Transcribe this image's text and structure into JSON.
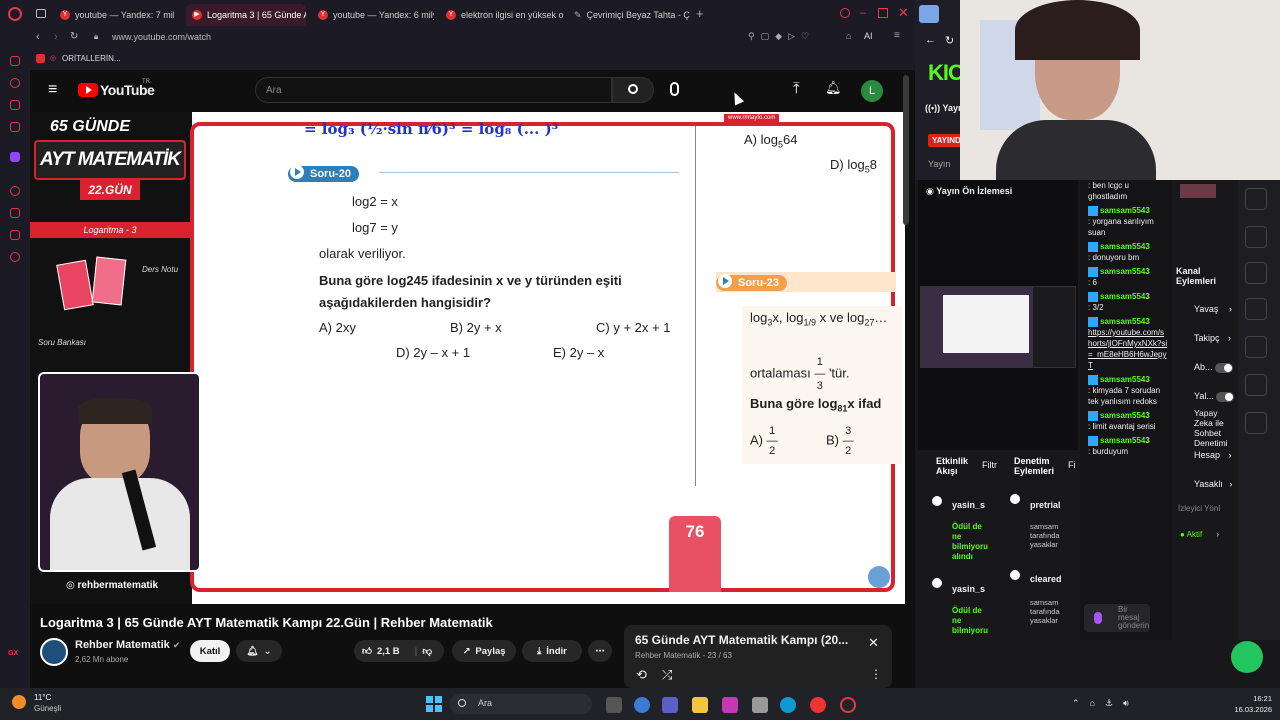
{
  "browser": {
    "tabs": [
      {
        "label": "youtube — Yandex: 7 milyon",
        "active": false
      },
      {
        "label": "Logaritma 3 | 65 Günde A",
        "active": true
      },
      {
        "label": "youtube — Yandex: 6 milyo",
        "active": false
      },
      {
        "label": "elektron ilgisi en yüksek o",
        "active": false
      },
      {
        "label": "Çevrimiçi Beyaz Tahta - Ç",
        "active": false
      }
    ],
    "address": "www.youtube.com/watch",
    "bookmark": "ORİTALLERİN...",
    "ai_label": "AI"
  },
  "youtube": {
    "logo": "YouTube",
    "country": "TR",
    "search_placeholder": "Ara",
    "avatar": "L"
  },
  "video": {
    "promo_title_top": "65 GÜNDE",
    "promo_title_main": "AYT MATEMATİK",
    "promo_day": "22.GÜN",
    "promo_topic": "Logaritma - 3",
    "promo_note": "Ders Notu",
    "promo_bank": "Soru Bankası",
    "instagram": "rehbermatematik",
    "site": "www.rmtayfo.com",
    "page_number": "76",
    "soru20": {
      "head": "Soru-20",
      "line1": "log2 = x",
      "line2": "log7 = y",
      "line3": "olarak veriliyor.",
      "question": "Buna göre log245 ifadesinin x ve y türünden eşiti aşağıdakilerden hangisidir?",
      "opts": [
        "A) 2xy",
        "B) 2y + x",
        "C) y + 2x + 1",
        "D) 2y – x + 1",
        "E) 2y – x"
      ]
    },
    "soru23": {
      "head": "Soru-23",
      "text_a": "log",
      "text_mid": "ortalaması",
      "text_tur": "'tür.",
      "question": "Buna göre log",
      "q_tail": "x ifad",
      "opt_a": "A)",
      "opt_b": "B)"
    },
    "right_top": {
      "a": "A) log",
      "a_base": "5",
      "a_val": "64",
      "d": "D) log",
      "d_base": "5",
      "d_val": "8"
    }
  },
  "below": {
    "title": "Logaritma 3 | 65 Günde AYT Matematik Kampı 22.Gün | Rehber Matematik",
    "channel": "Rehber Matematik",
    "subs": "2,62 Mn abone",
    "join": "Katıl",
    "likes": "2,1 B",
    "share": "Paylaş",
    "download": "İndir"
  },
  "playlist": {
    "title": "65 Günde AYT Matematik Kampı (20...",
    "meta": "Rehber Matematik - 23 / 63"
  },
  "kick": {
    "logo": "KIC",
    "yayin": "Yayın",
    "yayinda": "YAYINDA",
    "onizleme": "Yayın Ön İzlemesi",
    "chat": [
      {
        "user": "",
        "text": ": ben lcgc u ghostladım"
      },
      {
        "user": "samsam5543",
        "text": ": yorgana sarılıyım suan"
      },
      {
        "user": "samsam5543",
        "text": ": donuyoru bm"
      },
      {
        "user": "samsam5543",
        "text": ": 6"
      },
      {
        "user": "samsam5543",
        "text": ": 3/2"
      },
      {
        "user": "samsam5543",
        "text": "https://youtube.com/shorts/jlOFnMyxNXk?si=_mE8eHB6H6wJepyT"
      },
      {
        "user": "samsam5543",
        "text": ": kimyada 7 sorudan tek yanlısım redoks"
      },
      {
        "user": "samsam5543",
        "text": ": limit avantaj serisi"
      },
      {
        "user": "samsam5543",
        "text": ": burduyum"
      }
    ],
    "send_placeholder": "Bir mesaj gönderin",
    "side": {
      "kanal": "Kanal Eylemleri",
      "yavas": "Yavaş",
      "takipci": "Takipç",
      "abone": "Ab...",
      "yal": "Yal...",
      "yapay": "Yapay Zeka ile Sohbet Denetimi",
      "hesap": "Hesap",
      "yasakli": "Yasaklı",
      "izleyici": "İzleyici Yönl",
      "aktif": "Aktif"
    },
    "events": {
      "etkinlik": "Etkinlik Akışı",
      "filtre": "Filtr",
      "denetim": "Denetim Eylemleri",
      "f": "Fi",
      "rows": [
        {
          "name": "yasin_s",
          "desc": "Ödül de ne bilmiyoru alındı"
        },
        {
          "name": "yasin_s",
          "desc": "Ödül de ne bilmiyoru"
        }
      ],
      "mod_rows": [
        {
          "name": "pretrial",
          "desc": "samsam tarafında yasaklar"
        },
        {
          "name": "cleared",
          "desc": "samsam tarafında yasaklar"
        }
      ]
    }
  },
  "taskbar": {
    "weather": "11°C",
    "weather_desc": "Güneşli",
    "search": "Ara",
    "time": "16:21",
    "date": "16.03.2026"
  }
}
